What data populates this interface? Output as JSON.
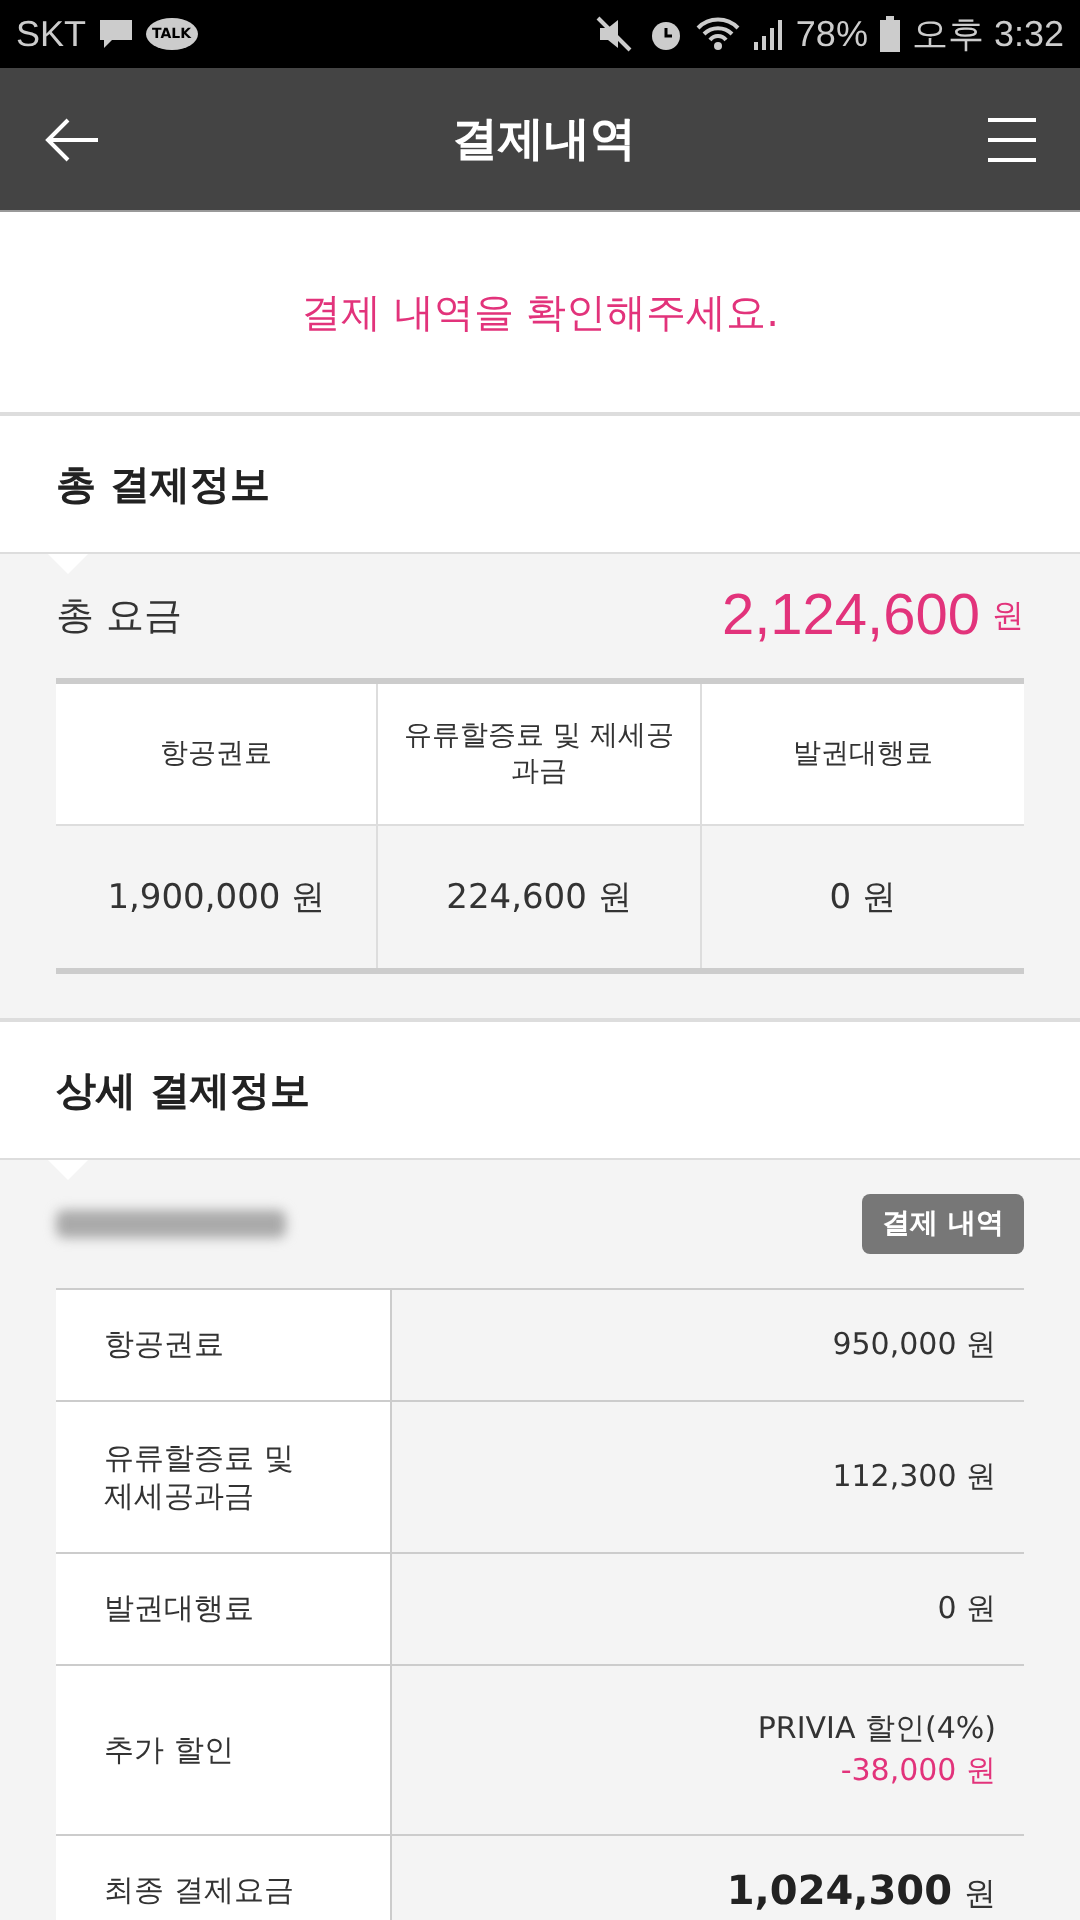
{
  "status_bar": {
    "carrier": "SKT",
    "talk_badge": "TALK",
    "battery": "78%",
    "time": "오후 3:32"
  },
  "app_bar": {
    "title": "결제내역"
  },
  "notice": "결제 내역을 확인해주세요.",
  "summary": {
    "title": "총 결제정보",
    "total_label": "총 요금",
    "total_amount": "2,124,600",
    "total_unit": "원",
    "columns": [
      {
        "label": "항공권료",
        "value": "1,900,000 원"
      },
      {
        "label": "유류할증료 및 제세공과금",
        "value": "224,600 원"
      },
      {
        "label": "발권대행료",
        "value": "0 원"
      }
    ]
  },
  "detail": {
    "title": "상세 결제정보",
    "badge": "결제 내역",
    "rows": [
      {
        "kind": "plain",
        "label": "항공권료",
        "value": "950,000 원"
      },
      {
        "kind": "plain",
        "label": "유류할증료 및\n제세공과금",
        "value": "112,300 원"
      },
      {
        "kind": "plain",
        "label": "발권대행료",
        "value": "0 원"
      },
      {
        "kind": "discount",
        "label": "추가 할인",
        "note": "PRIVIA 할인(4%)",
        "value": "-38,000 원"
      },
      {
        "kind": "total",
        "label": "최종 결제요금",
        "value": "1,024,300",
        "unit": "원"
      }
    ]
  }
}
